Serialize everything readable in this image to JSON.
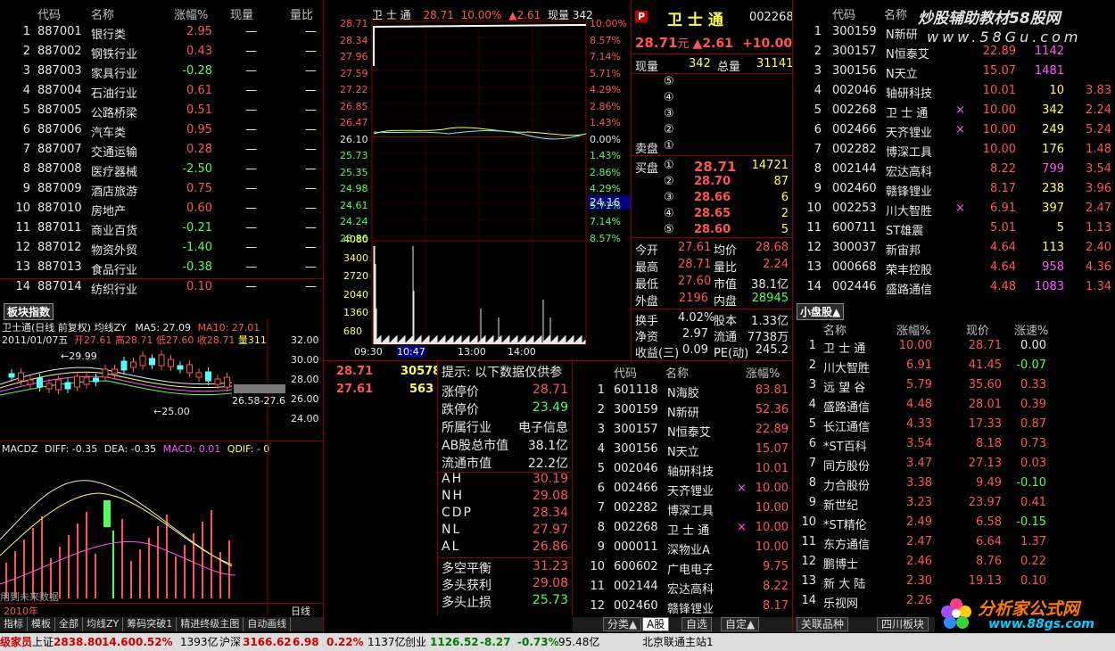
{
  "sector_list": {
    "headers": [
      "代码",
      "名称",
      "涨幅%",
      "现量",
      "量比"
    ],
    "rows": [
      {
        "n": "1",
        "code": "887001",
        "name": "银行类",
        "pct": "2.95",
        "vol": "—",
        "ratio": "—"
      },
      {
        "n": "2",
        "code": "887002",
        "name": "钢铁行业",
        "pct": "0.43",
        "vol": "—",
        "ratio": "—"
      },
      {
        "n": "3",
        "code": "887003",
        "name": "家具行业",
        "pct": "-0.28",
        "vol": "—",
        "ratio": "—"
      },
      {
        "n": "4",
        "code": "887004",
        "name": "石油行业",
        "pct": "0.61",
        "vol": "—",
        "ratio": "—"
      },
      {
        "n": "5",
        "code": "887005",
        "name": "公路桥梁",
        "pct": "0.51",
        "vol": "—",
        "ratio": "—"
      },
      {
        "n": "6",
        "code": "887006",
        "name": "汽车类",
        "pct": "0.95",
        "vol": "—",
        "ratio": "—"
      },
      {
        "n": "7",
        "code": "887007",
        "name": "交通运输",
        "pct": "0.28",
        "vol": "—",
        "ratio": "—"
      },
      {
        "n": "8",
        "code": "887008",
        "name": "医疗器械",
        "pct": "-2.50",
        "vol": "—",
        "ratio": "—"
      },
      {
        "n": "9",
        "code": "887009",
        "name": "酒店旅游",
        "pct": "0.75",
        "vol": "—",
        "ratio": "—"
      },
      {
        "n": "10",
        "code": "887010",
        "name": "房地产",
        "pct": "0.60",
        "vol": "—",
        "ratio": "—"
      },
      {
        "n": "11",
        "code": "887011",
        "name": "商业百货",
        "pct": "-0.21",
        "vol": "—",
        "ratio": "—"
      },
      {
        "n": "12",
        "code": "887012",
        "name": "物资外贸",
        "pct": "-1.40",
        "vol": "—",
        "ratio": "—"
      },
      {
        "n": "13",
        "code": "887013",
        "name": "食品行业",
        "pct": "-0.38",
        "vol": "—",
        "ratio": "—"
      },
      {
        "n": "14",
        "code": "887014",
        "name": "纺织行业",
        "pct": "0.10",
        "vol": "—",
        "ratio": "—"
      }
    ]
  },
  "section_title": "板块指数",
  "kline": {
    "title": "卫士通(日线 前复权) 均线ZY",
    "ma5": "MA5: 27.09",
    "ma10": "MA10: 27.01",
    "info_date": "2011/01/07五",
    "info_open": "开27.61",
    "info_high": "高28.71",
    "info_low": "低27.60",
    "info_close": "收28.71",
    "info_vol": "量311",
    "price_hi": "←29.99",
    "price_lo": "←25.00",
    "range": "26.58-27.6",
    "yticks": [
      "32.00",
      "30.00",
      "28.00",
      "26.00",
      "24.00"
    ],
    "macd_title": "MACDZ",
    "diff": "DIFF: -0.35",
    "dea": "DEA: -0.35",
    "macd": "MACD: 0.01",
    "qdif": "QDIF: - 0",
    "note": "用到未来数据",
    "year": "2010年",
    "period": "日线"
  },
  "intraday": {
    "name": "卫 士 通",
    "price": "28.71",
    "pct": "10.00%",
    "chg": "▲2.61",
    "vol_label": "现量 342",
    "left_ticks": [
      "28.71",
      "28.34",
      "27.96",
      "27.59",
      "27.22",
      "26.85",
      "26.47",
      "26.10",
      "25.73",
      "25.35",
      "24.98",
      "24.61",
      "24.24",
      "23.86"
    ],
    "right_ticks": [
      "10.00%",
      "8.57%",
      "7.14%",
      "5.71%",
      "4.29%",
      "2.86%",
      "1.43%",
      "0.00%",
      "1.43%",
      "2.86%",
      "4.29%",
      "5.71%",
      "7.14%",
      "8.57%"
    ],
    "vol_ticks": [
      "4080",
      "3400",
      "2720",
      "2040",
      "1360",
      "680"
    ],
    "times": [
      "09:30",
      "10:47",
      "13:00",
      "14:00"
    ],
    "cursor_val": "24.16",
    "sub_price1": "28.71",
    "sub_vol1": "30578",
    "sub_price2": "27.61",
    "sub_vol2": "563"
  },
  "quote": {
    "flag": "P",
    "name": "卫 士 通",
    "code": "002268",
    "price": "28.71",
    "unit": "元",
    "chg": "▲2.61",
    "pct": "+10.00",
    "cur_vol_label": "现量",
    "cur_vol": "342",
    "total_vol_label": "总量",
    "total_vol": "31141",
    "sell_levels": [
      "⑤",
      "④",
      "③",
      "②",
      "①"
    ],
    "sell_label": "卖盘",
    "buy_label": "买盘",
    "buy": [
      {
        "lv": "①",
        "p": "28.71",
        "v": "14721"
      },
      {
        "lv": "②",
        "p": "28.70",
        "v": "87"
      },
      {
        "lv": "③",
        "p": "28.66",
        "v": "6"
      },
      {
        "lv": "④",
        "p": "28.65",
        "v": "2"
      },
      {
        "lv": "⑤",
        "p": "28.60",
        "v": "5"
      }
    ],
    "stats": [
      [
        "今开",
        "27.61",
        "均价",
        "28.68"
      ],
      [
        "最高",
        "28.71",
        "量比",
        "2.24"
      ],
      [
        "最低",
        "27.60",
        "市值",
        "38.1亿"
      ],
      [
        "外盘",
        "2196",
        "内盘",
        "28945"
      ]
    ],
    "stats2": [
      [
        "换手",
        "4.02%",
        "股本",
        "1.33亿"
      ],
      [
        "净资",
        "2.97",
        "流通",
        "7738万"
      ],
      [
        "收益(三)",
        "0.09",
        "PE(动)",
        "245.2"
      ]
    ]
  },
  "tips": {
    "title": "提示: 以下数据仅供参",
    "rows": [
      [
        "涨停价",
        "28.71"
      ],
      [
        "跌停价",
        "23.49"
      ],
      [
        "所属行业",
        "电子信息"
      ],
      [
        "AB股总市值",
        "38.1亿"
      ],
      [
        "流通市值",
        "22.2亿"
      ]
    ],
    "ind": [
      [
        "AH",
        "30.19"
      ],
      [
        "NH",
        "29.08"
      ],
      [
        "CDP",
        "28.34"
      ],
      [
        "NL",
        "27.97"
      ],
      [
        "AL",
        "26.86"
      ]
    ],
    "bottom": [
      [
        "多空平衡",
        "31.23"
      ],
      [
        "多头获利",
        "29.08"
      ],
      [
        "多头止损",
        "25.73"
      ]
    ]
  },
  "rank_mid": {
    "headers": [
      "代码",
      "名称",
      "涨幅%"
    ],
    "rows": [
      {
        "n": "1",
        "code": "601118",
        "name": "N海胶",
        "pct": "83.81",
        "x": ""
      },
      {
        "n": "2",
        "code": "300159",
        "name": "N新研",
        "pct": "52.36",
        "x": ""
      },
      {
        "n": "3",
        "code": "300157",
        "name": "N恒泰艾",
        "pct": "22.89",
        "x": ""
      },
      {
        "n": "4",
        "code": "300156",
        "name": "N天立",
        "pct": "15.07",
        "x": ""
      },
      {
        "n": "5",
        "code": "002046",
        "name": "轴研科技",
        "pct": "10.01",
        "x": ""
      },
      {
        "n": "6",
        "code": "002466",
        "name": "天齐锂业",
        "pct": "10.00",
        "x": "×"
      },
      {
        "n": "7",
        "code": "002282",
        "name": "博深工具",
        "pct": "10.00",
        "x": ""
      },
      {
        "n": "8",
        "code": "002268",
        "name": "卫 士 通",
        "pct": "10.00",
        "x": "×"
      },
      {
        "n": "9",
        "code": "000011",
        "name": "深物业A",
        "pct": "10.00",
        "x": ""
      },
      {
        "n": "10",
        "code": "600602",
        "name": "广电电子",
        "pct": "9.75",
        "x": ""
      },
      {
        "n": "11",
        "code": "002144",
        "name": "宏达高科",
        "pct": "8.22",
        "x": ""
      },
      {
        "n": "12",
        "code": "002460",
        "name": "赣锋锂业",
        "pct": "8.17",
        "x": ""
      }
    ],
    "tabs": [
      "分类▲",
      "A股",
      "自选",
      "自定▲"
    ]
  },
  "rank_right": {
    "headers": [
      "代码",
      "名称"
    ],
    "rows": [
      {
        "n": "1",
        "code": "300159",
        "name": "N新研",
        "pct": "",
        "vol": "",
        "sp": "",
        "x": ""
      },
      {
        "n": "2",
        "code": "300157",
        "name": "N恒泰艾",
        "pct": "22.89",
        "vol": "1142",
        "sp": "",
        "x": ""
      },
      {
        "n": "3",
        "code": "300156",
        "name": "N天立",
        "pct": "15.07",
        "vol": "1481",
        "sp": "",
        "x": ""
      },
      {
        "n": "4",
        "code": "002046",
        "name": "轴研科技",
        "pct": "10.01",
        "vol": "10",
        "sp": "3.83",
        "x": ""
      },
      {
        "n": "5",
        "code": "002268",
        "name": "卫 士 通",
        "pct": "10.00",
        "vol": "342",
        "sp": "2.24",
        "x": "×"
      },
      {
        "n": "6",
        "code": "002466",
        "name": "天齐锂业",
        "pct": "10.00",
        "vol": "249",
        "sp": "5.24",
        "x": "×"
      },
      {
        "n": "7",
        "code": "002282",
        "name": "博深工具",
        "pct": "10.00",
        "vol": "176",
        "sp": "1.48",
        "x": ""
      },
      {
        "n": "8",
        "code": "002144",
        "name": "宏达高科",
        "pct": "8.22",
        "vol": "799",
        "sp": "3.54",
        "x": ""
      },
      {
        "n": "9",
        "code": "002460",
        "name": "赣锋锂业",
        "pct": "8.17",
        "vol": "238",
        "sp": "3.96",
        "x": ""
      },
      {
        "n": "10",
        "code": "002253",
        "name": "川大智胜",
        "pct": "6.91",
        "vol": "397",
        "sp": "2.47",
        "x": "×"
      },
      {
        "n": "11",
        "code": "600711",
        "name": "ST雄震",
        "pct": "5.01",
        "vol": "5",
        "sp": "1.13",
        "x": ""
      },
      {
        "n": "12",
        "code": "300037",
        "name": "新宙邦",
        "pct": "4.64",
        "vol": "113",
        "sp": "2.40",
        "x": ""
      },
      {
        "n": "13",
        "code": "000668",
        "name": "荣丰控股",
        "pct": "4.64",
        "vol": "958",
        "sp": "4.36",
        "x": ""
      },
      {
        "n": "14",
        "code": "002446",
        "name": "盛路通信",
        "pct": "4.48",
        "vol": "1083",
        "sp": "1.34",
        "x": ""
      }
    ]
  },
  "small_cap": {
    "title": "小盘股▲",
    "headers": [
      "名称",
      "涨幅%",
      "现价",
      "涨速%"
    ],
    "rows": [
      {
        "n": "1",
        "name": "卫 士 通",
        "pct": "10.00",
        "price": "28.71",
        "sp": "0.00"
      },
      {
        "n": "2",
        "name": "川大智胜",
        "pct": "6.91",
        "price": "41.45",
        "sp": "-0.07"
      },
      {
        "n": "3",
        "name": "远 望 谷",
        "pct": "5.79",
        "price": "35.60",
        "sp": "0.33"
      },
      {
        "n": "4",
        "name": "盛路通信",
        "pct": "4.48",
        "price": "28.01",
        "sp": "0.39"
      },
      {
        "n": "5",
        "name": "长江通信",
        "pct": "4.33",
        "price": "17.33",
        "sp": "0.87"
      },
      {
        "n": "6",
        "name": "*ST百科",
        "pct": "3.54",
        "price": "8.18",
        "sp": "0.73"
      },
      {
        "n": "7",
        "name": "同方股份",
        "pct": "3.47",
        "price": "27.13",
        "sp": "0.03"
      },
      {
        "n": "8",
        "name": "力合股份",
        "pct": "3.38",
        "price": "9.49",
        "sp": "-0.10"
      },
      {
        "n": "9",
        "name": "新世纪",
        "pct": "3.23",
        "price": "23.97",
        "sp": "0.41"
      },
      {
        "n": "10",
        "name": "*ST精伦",
        "pct": "2.49",
        "price": "6.58",
        "sp": "-0.15"
      },
      {
        "n": "11",
        "name": "东方通信",
        "pct": "2.47",
        "price": "6.64",
        "sp": "1.37"
      },
      {
        "n": "12",
        "name": "鹏博士",
        "pct": "2.46",
        "price": "8.76",
        "sp": "0.22"
      },
      {
        "n": "13",
        "name": "新 大 陆",
        "pct": "2.30",
        "price": "19.13",
        "sp": "0.10"
      },
      {
        "n": "14",
        "name": "乐视网",
        "pct": "2.26",
        "price": "",
        "sp": ""
      }
    ],
    "tabs": [
      "关联品种",
      "四川板块"
    ]
  },
  "watermark_top": "炒股辅助教材58股网",
  "watermark_url": "www.58Gu.com",
  "logo_text": "分析家公式网",
  "logo_url": "www.88gs.com",
  "bottom_tabs": [
    "指标",
    "模板",
    "全部",
    "均线ZY",
    "筹码突破1",
    "精进终级主图",
    "自动画线"
  ],
  "status": {
    "lead": "级家员",
    "sh_label": "上证",
    "sh_val": "2838.80",
    "sh_chg": "14.60",
    "sh_pct": "0.52%",
    "sh_amt": "1393亿",
    "sz_label": "沪深",
    "sz_val": "3166.62",
    "sz_chg": "6.98",
    "sz_pct": "0.22%",
    "sz_amt": "1137亿",
    "cy_label": "创业",
    "cy_val": "1126.52",
    "cy_chg": "-8.27",
    "cy_pct": "-0.73%",
    "cy_amt": "95.48亿",
    "server": "北京联通主站1"
  }
}
